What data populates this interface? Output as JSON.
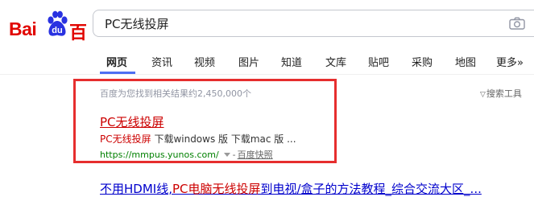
{
  "brand": {
    "logo_latin": "Bai",
    "logo_paw_text": "du",
    "logo_cn": "百度",
    "color": "#e10601"
  },
  "search": {
    "query": "PC无线投屏",
    "camera_icon": "camera-icon"
  },
  "tabs": [
    {
      "label": "网页",
      "active": true
    },
    {
      "label": "资讯",
      "active": false
    },
    {
      "label": "视频",
      "active": false
    },
    {
      "label": "图片",
      "active": false
    },
    {
      "label": "知道",
      "active": false
    },
    {
      "label": "文库",
      "active": false
    },
    {
      "label": "贴吧",
      "active": false
    },
    {
      "label": "采购",
      "active": false
    },
    {
      "label": "地图",
      "active": false
    },
    {
      "label": "更多»",
      "active": false
    }
  ],
  "results_info": {
    "stats": "百度为您找到相关结果约2,450,000个",
    "tools_label": "搜索工具",
    "tools_icon": "funnel-icon"
  },
  "results": [
    {
      "title": "PC无线投屏",
      "snippet_highlight": "PC无线投屏",
      "snippet_rest": " 下载windows 版 下载mac 版 ...",
      "url": "https://mmpus.yunos.com/",
      "separator": "-",
      "cache_label": "百度快照"
    },
    {
      "title_part1": "不用HDMI线,",
      "title_highlight": "PC电脑无线投屏",
      "title_part2": "到电视/盒子的方法教程_综合交流大区_..."
    }
  ],
  "colors": {
    "accent_blue": "#4e6ef2",
    "highlight_red": "#e62e2e",
    "result_red": "#cc0000",
    "url_green": "#008000"
  }
}
